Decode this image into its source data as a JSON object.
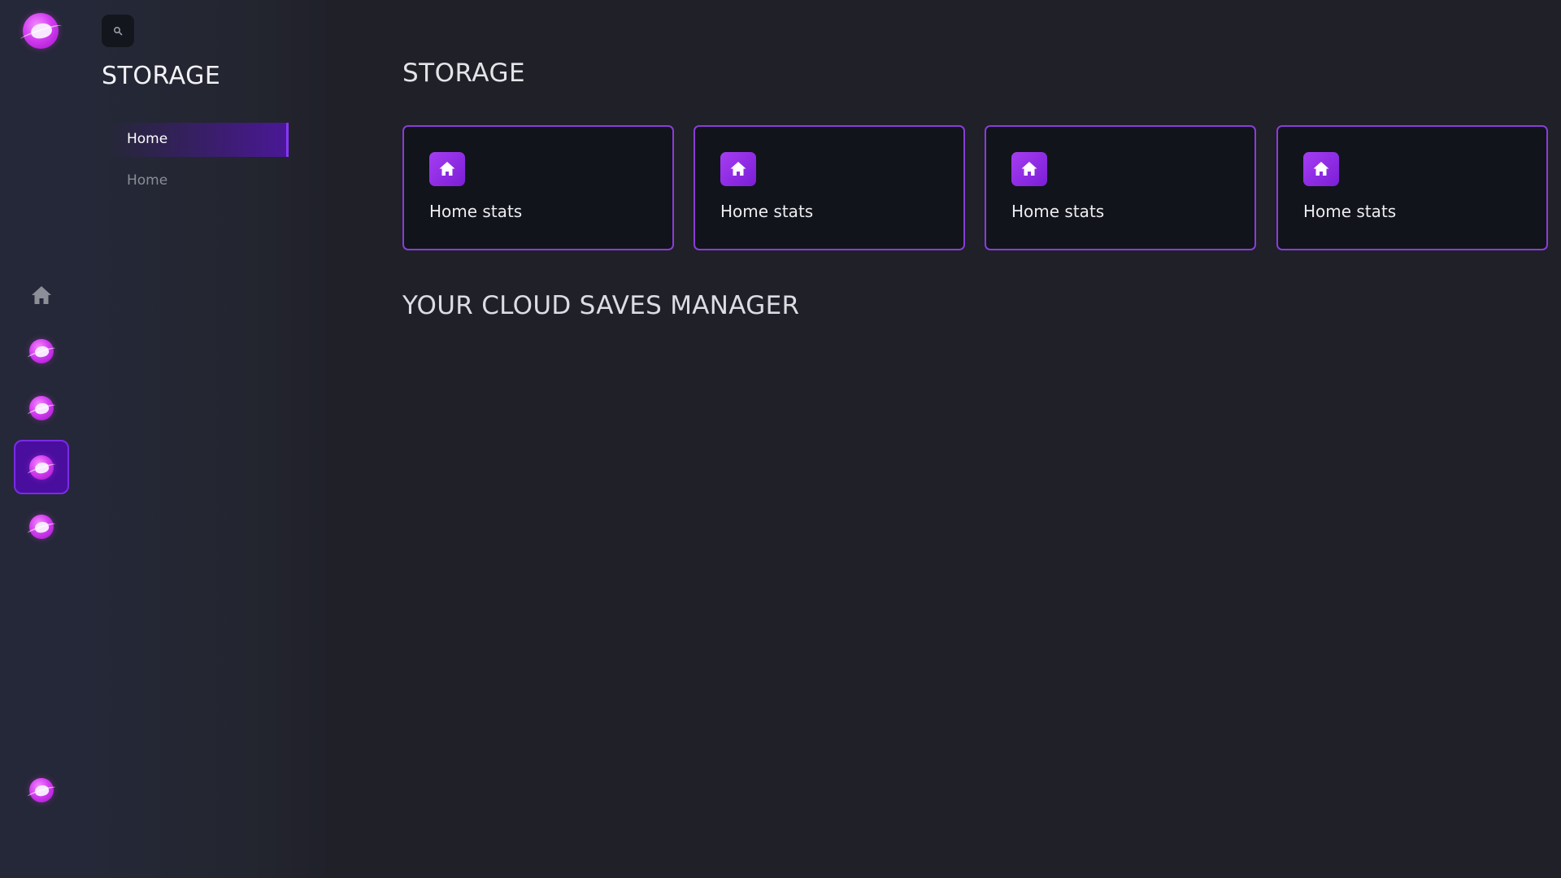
{
  "sidebar": {
    "logo_icon": "planet-icon",
    "items": [
      {
        "icon": "home-icon"
      },
      {
        "icon": "planet-icon"
      },
      {
        "icon": "planet-icon"
      },
      {
        "icon": "planet-icon",
        "active": true
      },
      {
        "icon": "planet-icon"
      },
      {
        "icon": "planet-icon"
      }
    ]
  },
  "panel": {
    "search_icon": "search-icon",
    "title": "STORAGE",
    "nav": [
      {
        "label": "Home",
        "active": true
      },
      {
        "label": "Home",
        "active": false
      }
    ]
  },
  "main": {
    "title": "STORAGE",
    "cards": [
      {
        "icon": "home-icon",
        "label": "Home stats"
      },
      {
        "icon": "home-icon",
        "label": "Home stats"
      },
      {
        "icon": "home-icon",
        "label": "Home stats"
      },
      {
        "icon": "home-icon",
        "label": "Home stats"
      }
    ],
    "section_title": "YOUR CLOUD SAVES MANAGER"
  },
  "colors": {
    "background": "#1f2028",
    "accent": "#8a3cd8",
    "active_nav": "#4a0e9e",
    "card_bg": "#11141b"
  }
}
